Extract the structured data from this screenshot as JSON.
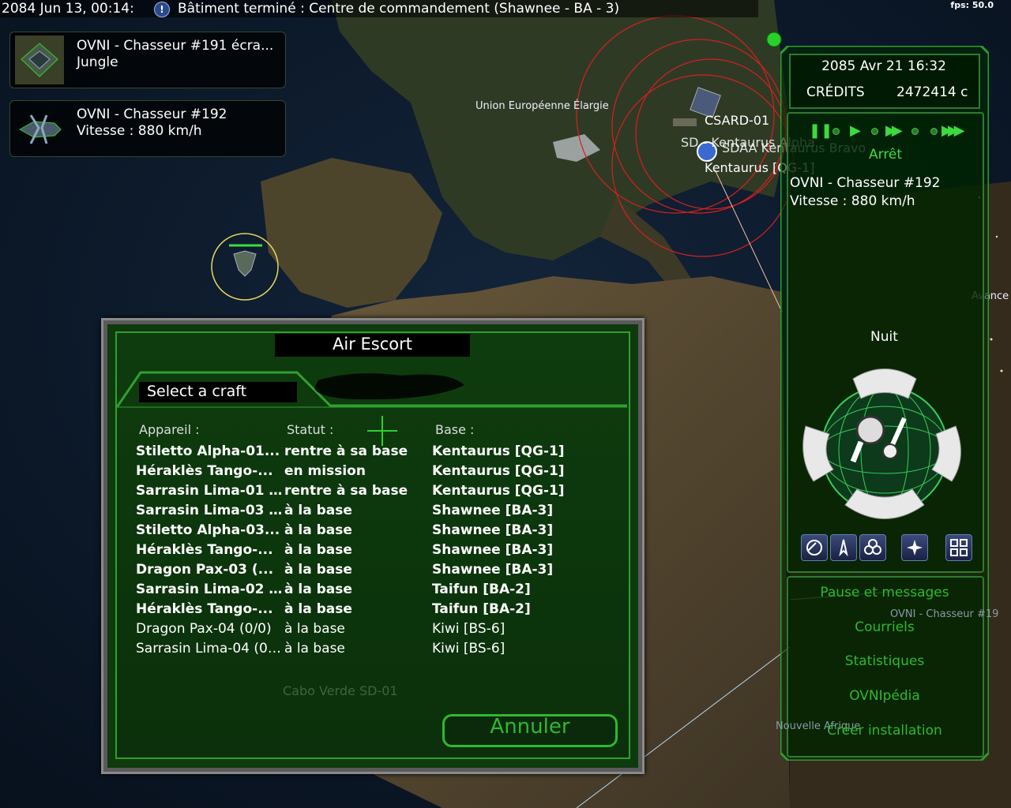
{
  "top_bar": {
    "date": "2084 Jun 13, 00:14:",
    "alert_icon": "!",
    "message": "Bâtiment terminé : Centre de commandement (Shawnee - BA - 3)",
    "fps": "fps: 50.0"
  },
  "notifications": [
    {
      "line1": "OVNI - Chasseur #191 écra...",
      "line2": "Jungle",
      "icon": "ufo-wreck-icon"
    },
    {
      "line1": "OVNI - Chasseur #192",
      "line2": "Vitesse : 880 km/h",
      "icon": "ufo-fighter-icon"
    }
  ],
  "map_labels": {
    "union": "Union Européenne Élargie",
    "csard": "CSARD-01",
    "sd_kentaurus": "SD - Kentaurus Alpha",
    "sdaa": "SDAA Kentaurus Bravo",
    "kentaurus": "Kentaurus [QG-1]",
    "right_edge": "Avance",
    "ufo_tag": "OVNI - Chasseur #19",
    "nouvelle": "Nouvelle Afrique"
  },
  "right_panel": {
    "date": "2085 Avr 21 16:32",
    "credits_label": "CRÉDITS",
    "credits_value": "2472414 c",
    "time_state": "Arrêt",
    "ufo_name": "OVNI - Chasseur #192",
    "ufo_speed": "Vitesse : 880 km/h",
    "daylight": "Nuit",
    "tools": [
      "radar-icon",
      "aircraft-icon",
      "biohazard-icon",
      "compass-icon",
      "grid-icon"
    ],
    "menu": [
      "Pause et messages",
      "Courriels",
      "Statistiques",
      "OVNIpédia",
      "Créer installation"
    ]
  },
  "dialog": {
    "title": "Air Escort",
    "tab": "Select a craft",
    "headers": {
      "craft": "Appareil :",
      "status": "Statut :",
      "base": "Base :"
    },
    "rows": [
      {
        "craft": "Stiletto Alpha-01...",
        "status": "rentre à sa base",
        "base": "Kentaurus [QG-1]",
        "bold": true
      },
      {
        "craft": "Héraklès Tango-...",
        "status": "en mission",
        "base": "Kentaurus [QG-1]",
        "bold": true
      },
      {
        "craft": "Sarrasin Lima-01 ...",
        "status": "rentre à sa base",
        "base": "Kentaurus [QG-1]",
        "bold": true
      },
      {
        "craft": "Sarrasin Lima-03 ...",
        "status": "à la base",
        "base": "Shawnee [BA-3]",
        "bold": true
      },
      {
        "craft": "Stiletto Alpha-03...",
        "status": "à la base",
        "base": "Shawnee [BA-3]",
        "bold": true
      },
      {
        "craft": "Héraklès Tango-...",
        "status": "à la base",
        "base": "Shawnee [BA-3]",
        "bold": true
      },
      {
        "craft": "Dragon Pax-03 (...",
        "status": "à la base",
        "base": "Shawnee [BA-3]",
        "bold": true
      },
      {
        "craft": "Sarrasin Lima-02 ...",
        "status": "à la base",
        "base": "Taifun [BA-2]",
        "bold": true
      },
      {
        "craft": "Héraklès Tango-...",
        "status": "à la base",
        "base": "Taifun [BA-2]",
        "bold": true
      },
      {
        "craft": "Dragon Pax-04 (0/0)",
        "status": "à la base",
        "base": "Kiwi [BS-6]",
        "bold": false
      },
      {
        "craft": "Sarrasin Lima-04 (0/...",
        "status": "à la base",
        "base": "Kiwi [BS-6]",
        "bold": false
      }
    ],
    "ghost_label": "Cabo Verde SD-01",
    "cancel": "Annuler"
  }
}
